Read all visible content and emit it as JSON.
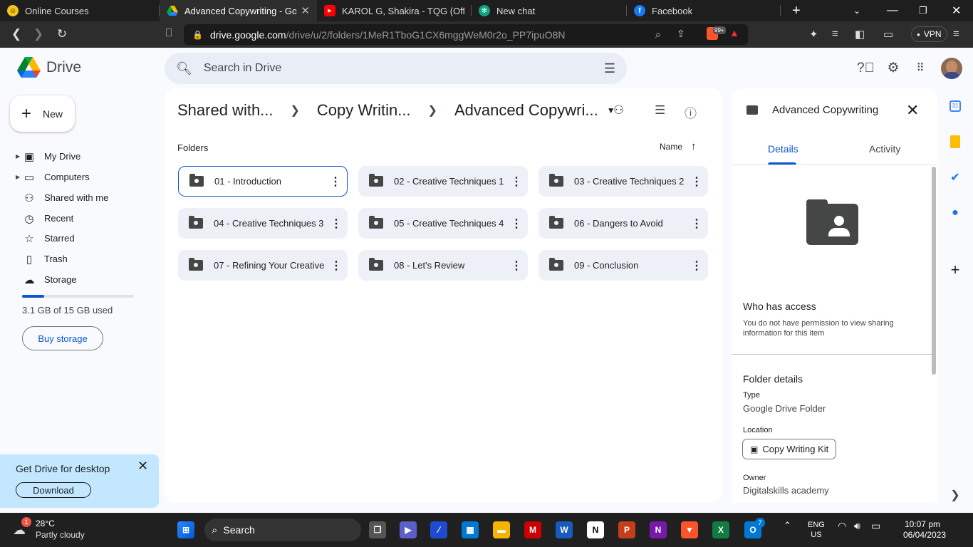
{
  "browser": {
    "tabs": [
      {
        "title": "Online Courses",
        "active": false
      },
      {
        "title": "Advanced Copywriting - Goog",
        "active": true
      },
      {
        "title": "KAROL G, Shakira - TQG (Official V",
        "active": false
      },
      {
        "title": "New chat",
        "active": false
      },
      {
        "title": "Facebook",
        "active": false
      }
    ],
    "new_tab": "+",
    "url_host": "drive.google.com",
    "url_path": "/drive/u/2/folders/1MeR1TboG1CX6mggWeM0r2o_PP7ipuO8N",
    "brave_badge": "99+",
    "vpn_label": "VPN"
  },
  "drive": {
    "logo_text": "Drive",
    "search_placeholder": "Search in Drive",
    "new_label": "New",
    "nav": [
      {
        "label": "My Drive",
        "icon": "my-drive-icon",
        "glyph": "▣"
      },
      {
        "label": "Computers",
        "icon": "computers-icon",
        "glyph": "▭"
      },
      {
        "label": "Shared with me",
        "icon": "shared-icon",
        "glyph": "👥"
      },
      {
        "label": "Recent",
        "icon": "clock-icon",
        "glyph": "◷"
      },
      {
        "label": "Starred",
        "icon": "star-icon",
        "glyph": "☆"
      },
      {
        "label": "Trash",
        "icon": "trash-icon",
        "glyph": "🗑"
      },
      {
        "label": "Storage",
        "icon": "cloud-icon",
        "glyph": "☁"
      }
    ],
    "storage_used_fraction": 0.2,
    "storage_text": "3.1 GB of 15 GB used",
    "buy_storage": "Buy storage",
    "promo": {
      "title": "Get Drive for desktop",
      "button": "Download"
    },
    "breadcrumbs": [
      "Shared with...",
      "Copy Writin...",
      "Advanced Copywri..."
    ],
    "folders_label": "Folders",
    "sort_label": "Name",
    "folders": [
      {
        "name": "01 - Introduction",
        "selected": true
      },
      {
        "name": "02 - Creative Techniques 1",
        "selected": false
      },
      {
        "name": "03 - Creative Techniques 2",
        "selected": false
      },
      {
        "name": "04 - Creative Techniques 3",
        "selected": false
      },
      {
        "name": "05 - Creative Techniques 4",
        "selected": false
      },
      {
        "name": "06 - Dangers to Avoid",
        "selected": false
      },
      {
        "name": "07 - Refining Your Creative",
        "selected": false
      },
      {
        "name": "08 - Let's Review",
        "selected": false
      },
      {
        "name": "09 - Conclusion",
        "selected": false
      }
    ]
  },
  "details": {
    "title": "Advanced Copywriting",
    "tabs": [
      "Details",
      "Activity"
    ],
    "access_heading": "Who has access",
    "access_text": "You do not have permission to view sharing information for this item",
    "folder_details_heading": "Folder details",
    "type_label": "Type",
    "type_value": "Google Drive Folder",
    "location_label": "Location",
    "location_value": "Copy Writing Kit",
    "owner_label": "Owner",
    "owner_value": "Digitalskills academy"
  },
  "taskbar": {
    "weather_badge": "1",
    "temperature": "28°C",
    "condition": "Partly cloudy",
    "search_label": "Search",
    "lang_line1": "ENG",
    "lang_line2": "US",
    "time": "10:07 pm",
    "date": "06/04/2023",
    "notif_badge": "7"
  },
  "colors": {
    "accent": "#0b57d0",
    "folder_bg": "#edf1f7",
    "promo_bg": "#c2e7ff"
  }
}
